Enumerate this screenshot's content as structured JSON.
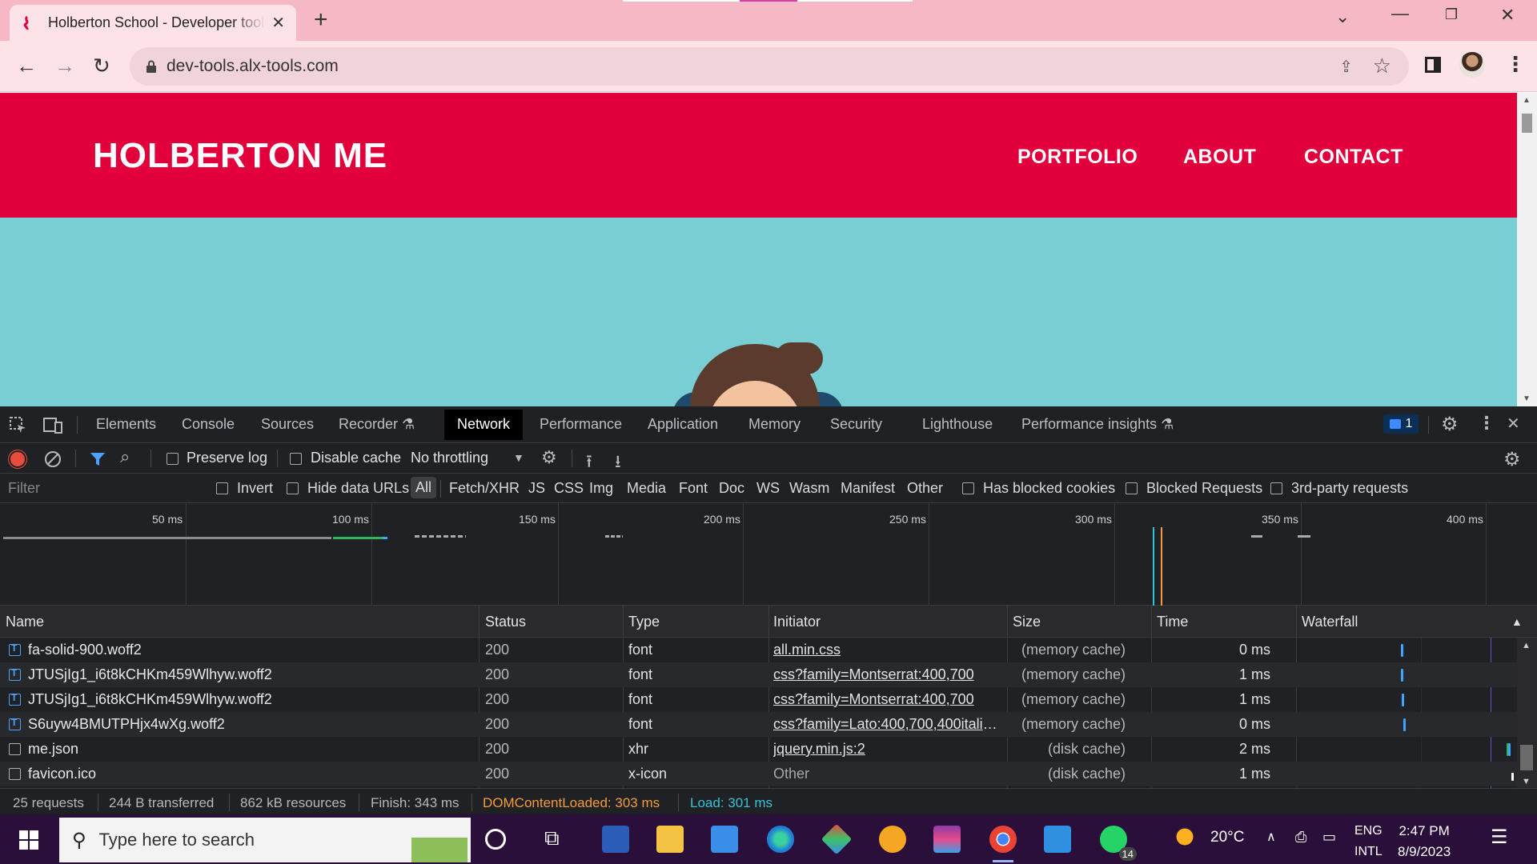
{
  "browser": {
    "tab_title": "Holberton School - Developer tools",
    "url": "dev-tools.alx-tools.com",
    "new_tab": "+",
    "close_tab": "✕"
  },
  "site": {
    "title": "HOLBERTON ME",
    "nav": [
      "PORTFOLIO",
      "ABOUT",
      "CONTACT"
    ],
    "colors": {
      "header": "#e1003c",
      "hero": "#78ced3"
    }
  },
  "devtools": {
    "tabs": [
      "Elements",
      "Console",
      "Sources",
      "Recorder",
      "Network",
      "Performance",
      "Application",
      "Memory",
      "Security",
      "Lighthouse",
      "Performance insights"
    ],
    "active_tab": "Network",
    "issues_count": "1",
    "toolbar": {
      "preserve_log": "Preserve log",
      "disable_cache": "Disable cache",
      "throttling": "No throttling"
    },
    "filter": {
      "placeholder": "Filter",
      "invert": "Invert",
      "hide_data_urls": "Hide data URLs",
      "types": [
        "All",
        "Fetch/XHR",
        "JS",
        "CSS",
        "Img",
        "Media",
        "Font",
        "Doc",
        "WS",
        "Wasm",
        "Manifest",
        "Other"
      ],
      "selected_type": "All",
      "has_blocked_cookies": "Has blocked cookies",
      "blocked_requests": "Blocked Requests",
      "third_party": "3rd-party requests"
    },
    "overview_ticks": [
      "50 ms",
      "100 ms",
      "150 ms",
      "200 ms",
      "250 ms",
      "300 ms",
      "350 ms",
      "400 ms"
    ],
    "columns": [
      "Name",
      "Status",
      "Type",
      "Initiator",
      "Size",
      "Time",
      "Waterfall"
    ],
    "requests": [
      {
        "name": "fa-solid-900.woff2",
        "status": "200",
        "type": "font",
        "initiator": "all.min.css",
        "size": "(memory cache)",
        "time": "0 ms",
        "icon": "font"
      },
      {
        "name": "JTUSjIg1_i6t8kCHKm459Wlhyw.woff2",
        "status": "200",
        "type": "font",
        "initiator": "css?family=Montserrat:400,700",
        "size": "(memory cache)",
        "time": "1 ms",
        "icon": "font"
      },
      {
        "name": "JTUSjIg1_i6t8kCHKm459Wlhyw.woff2",
        "status": "200",
        "type": "font",
        "initiator": "css?family=Montserrat:400,700",
        "size": "(memory cache)",
        "time": "1 ms",
        "icon": "font"
      },
      {
        "name": "S6uyw4BMUTPHjx4wXg.woff2",
        "status": "200",
        "type": "font",
        "initiator": "css?family=Lato:400,700,400italic,...",
        "size": "(memory cache)",
        "time": "0 ms",
        "icon": "font"
      },
      {
        "name": "me.json",
        "status": "200",
        "type": "xhr",
        "initiator": "jquery.min.js:2",
        "size": "(disk cache)",
        "time": "2 ms",
        "icon": "plain"
      },
      {
        "name": "favicon.ico",
        "status": "200",
        "type": "x-icon",
        "initiator": "Other",
        "size": "(disk cache)",
        "time": "1 ms",
        "icon": "plain"
      }
    ],
    "summary": {
      "requests": "25 requests",
      "transferred": "244 B transferred",
      "resources": "862 kB resources",
      "finish": "Finish: 343 ms",
      "dom_content_loaded": "DOMContentLoaded: 303 ms",
      "load": "Load: 301 ms"
    }
  },
  "taskbar": {
    "search_placeholder": "Type here to search",
    "weather": "20°C",
    "lang": "ENG",
    "layout": "INTL",
    "time": "2:47 PM",
    "date": "8/9/2023",
    "whatsapp_badge": "14"
  }
}
